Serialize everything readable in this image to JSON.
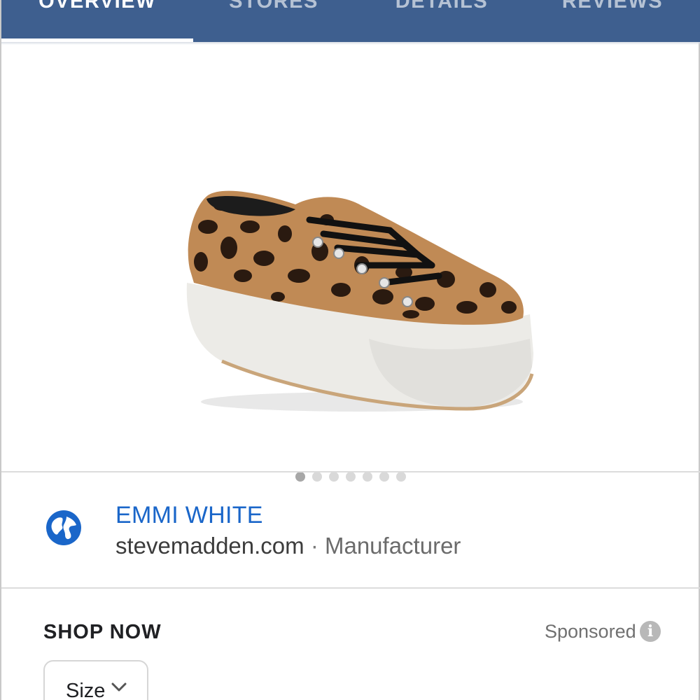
{
  "tabs": [
    {
      "label": "OVERVIEW",
      "active": true
    },
    {
      "label": "STORES",
      "active": false
    },
    {
      "label": "DETAILS",
      "active": false
    },
    {
      "label": "REVIEWS",
      "active": false
    }
  ],
  "gallery": {
    "image_icon": "leopard-print-platform-sneaker",
    "total_images": 7,
    "current_index": 1
  },
  "source": {
    "icon": "globe-icon",
    "product_name": "EMMI WHITE",
    "domain": "stevemadden.com",
    "separator": "·",
    "role": "Manufacturer"
  },
  "shop": {
    "title": "SHOP NOW",
    "sponsored_label": "Sponsored",
    "info_icon": "info-icon",
    "size_label": "Size",
    "size_icon": "chevron-down-icon"
  },
  "colors": {
    "tabbar": "#3e5f8f",
    "link": "#1a66c9"
  }
}
